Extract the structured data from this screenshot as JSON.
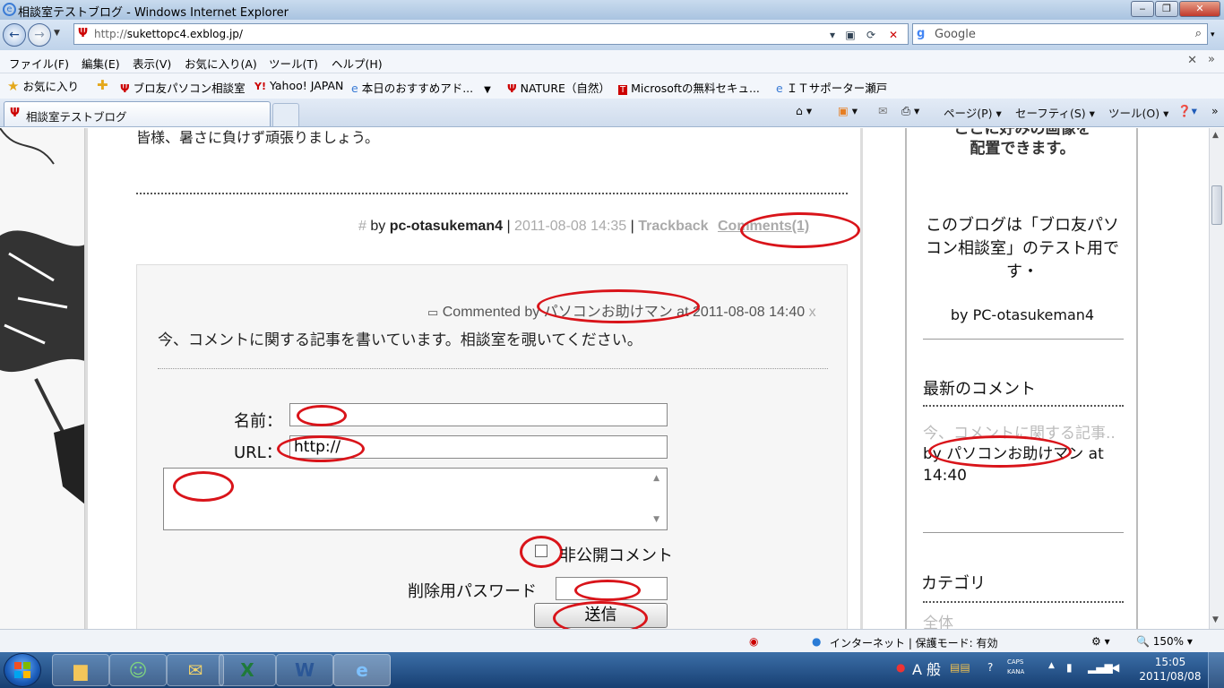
{
  "window": {
    "title": "相談室テストブログ - Windows Internet Explorer"
  },
  "address_bar": {
    "url_prefix": "http://",
    "url_domain": "sukettopc4.exblog.jp/"
  },
  "search": {
    "placeholder": "Google"
  },
  "menu": [
    "ファイル(F)",
    "編集(E)",
    "表示(V)",
    "お気に入り(A)",
    "ツール(T)",
    "ヘルプ(H)"
  ],
  "favorites": {
    "label": "お気に入り",
    "items": [
      "ブロ友パソコン相談室",
      "Yahoo! JAPAN",
      "本日のおすすめアド...",
      "NATURE（自然）",
      "Microsoftの無料セキュ...",
      "ＩＴサポーター瀬戸"
    ]
  },
  "tab": {
    "label": "相談室テストブログ"
  },
  "command_bar": {
    "page": "ページ(P)",
    "safety": "セーフティ(S)",
    "tools": "ツール(O)"
  },
  "post": {
    "closing_text": "皆様、暑さに負けず頑張りましょう。",
    "hash": "#",
    "by": "by",
    "author": "pc-otasukeman4",
    "sep": "|",
    "date": "2011-08-08 14:35",
    "trackback": "Trackback",
    "comments": "Comments(1)"
  },
  "comment": {
    "commented_by": "Commented by",
    "commenter": "パソコンお助けマン",
    "at": "at",
    "date": "2011-08-08 14:40",
    "delete": "x",
    "text": "今、コメントに関する記事を書いています。相談室を覗いてください。"
  },
  "form": {
    "name_label": "名前：",
    "url_label": "URL：",
    "url_value": "http://",
    "private_label": "非公開コメント",
    "password_label": "削除用パスワード",
    "submit_label": "送信"
  },
  "sidebar": {
    "top_text_1": "ここに好みの画像を",
    "top_text_2": "配置できます。",
    "desc": "このブログは「ブロ友パソコン相談室」のテスト用です・",
    "by_line": "by PC-otasukeman4",
    "recent_heading": "最新のコメント",
    "recent_item": "今、コメントに関する記事..",
    "recent_by": "by",
    "recent_author": "パソコンお助けマン",
    "recent_at": "at 14:40",
    "category_heading": "カテゴリ",
    "category_all": "全体"
  },
  "status_bar": {
    "zone": "インターネット | 保護モード: 有効",
    "zoom": "150%"
  },
  "taskbar": {
    "ime": "A 般",
    "caps": "CAPS",
    "kana": "KANA",
    "time": "15:05",
    "date": "2011/08/08"
  }
}
